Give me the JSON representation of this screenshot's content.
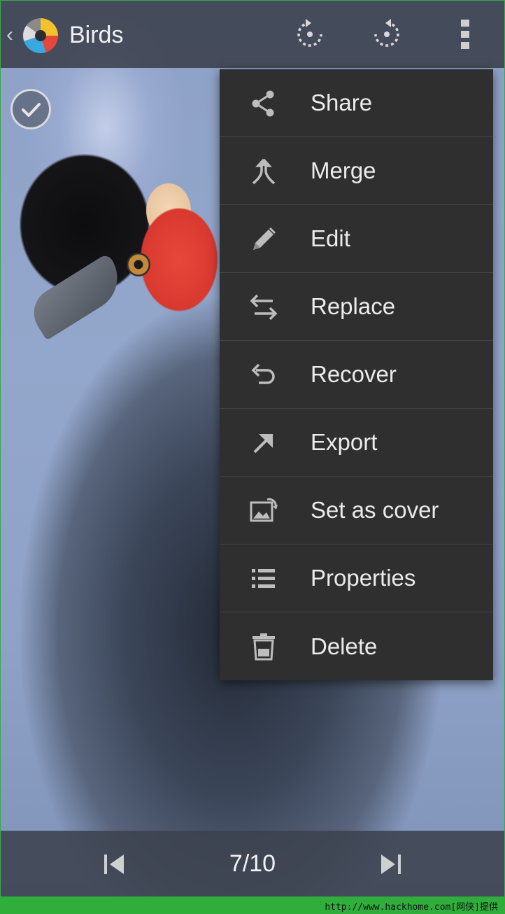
{
  "header": {
    "title": "Birds",
    "back_glyph": "‹",
    "icons": [
      "app-logo-icon",
      "rotate-left-icon",
      "rotate-right-icon",
      "overflow-menu-icon"
    ]
  },
  "menu": {
    "items": [
      {
        "label": "Share",
        "icon": "share-icon"
      },
      {
        "label": "Merge",
        "icon": "merge-icon"
      },
      {
        "label": "Edit",
        "icon": "pencil-icon"
      },
      {
        "label": "Replace",
        "icon": "swap-arrows-icon"
      },
      {
        "label": "Recover",
        "icon": "undo-icon"
      },
      {
        "label": "Export",
        "icon": "export-arrow-icon"
      },
      {
        "label": "Set as cover",
        "icon": "image-cover-icon"
      },
      {
        "label": "Properties",
        "icon": "list-icon"
      },
      {
        "label": "Delete",
        "icon": "trash-icon"
      }
    ]
  },
  "viewer": {
    "counter": "7/10",
    "selected": true
  },
  "watermark": {
    "text": "http://www.hackhome.com[网侠]提供"
  },
  "colors": {
    "menu_bg": "#2f2f2f",
    "watermark_bg": "#2fae3c"
  }
}
